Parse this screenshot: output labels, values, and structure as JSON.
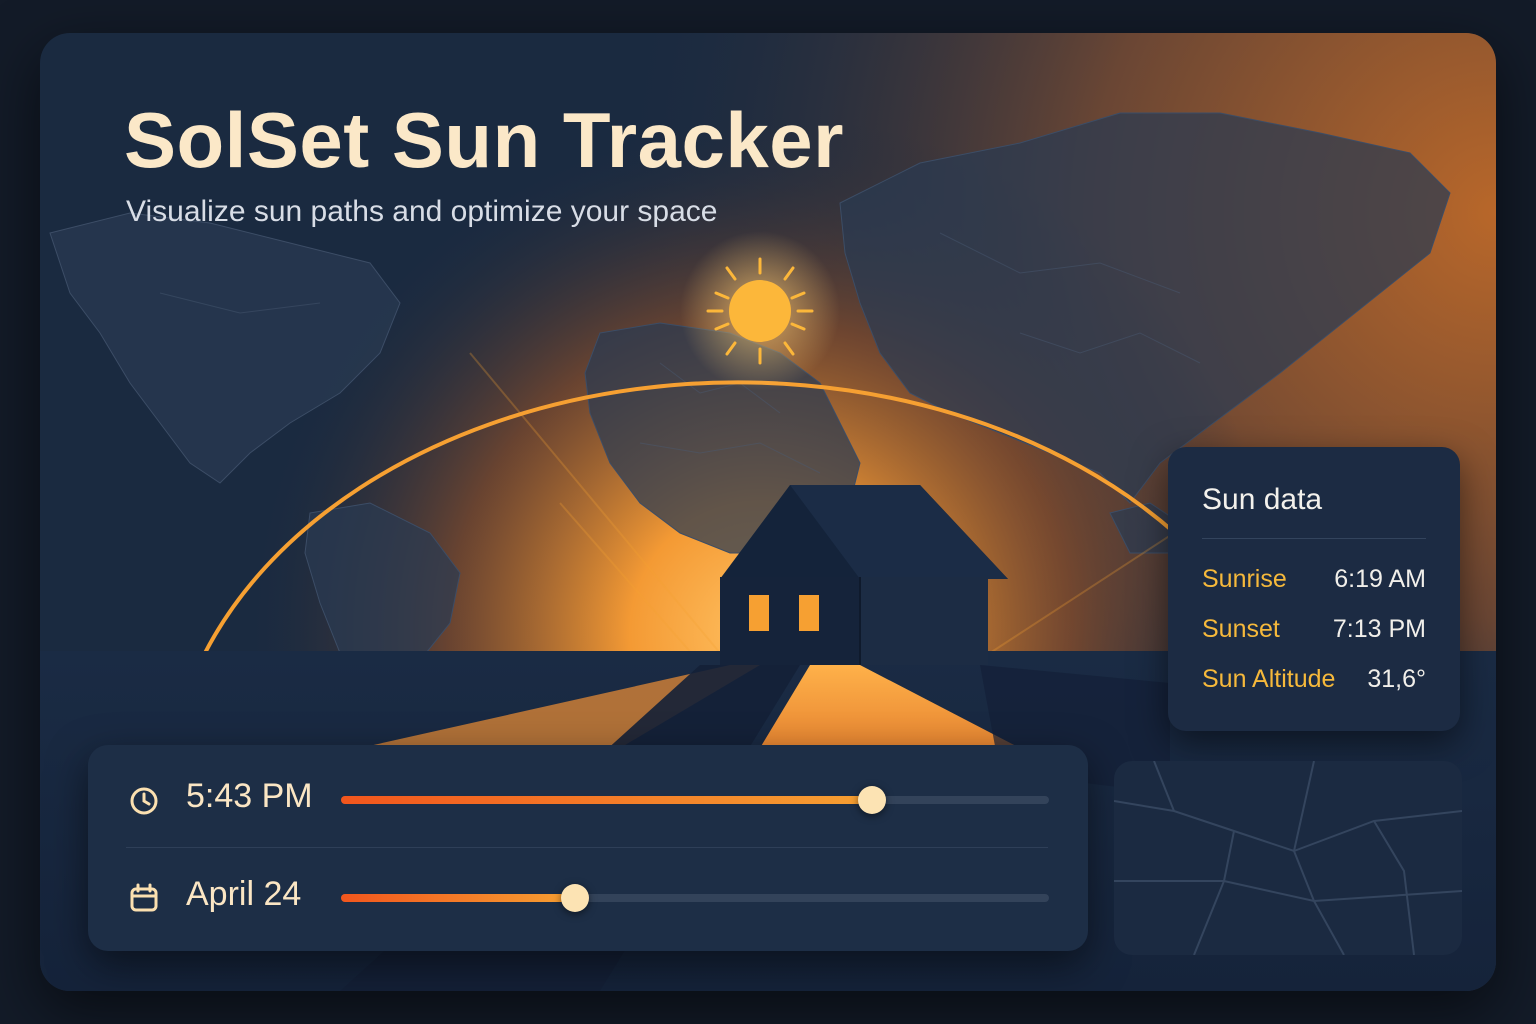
{
  "app": {
    "title": "SolSet Sun Tracker",
    "subtitle": "Visualize sun paths and optimize your space"
  },
  "sun_data": {
    "title": "Sun data",
    "rows": [
      {
        "label": "Sunrise",
        "value": "6:19 AM"
      },
      {
        "label": "Sunset",
        "value": "7:13 PM"
      },
      {
        "label": "Sun Altitude",
        "value": "31,6°"
      }
    ]
  },
  "controls": {
    "time": {
      "icon": "clock-icon",
      "value": "5:43 PM",
      "slider_fraction": 0.75
    },
    "date": {
      "icon": "calendar-icon",
      "value": "April 24",
      "slider_fraction": 0.33
    }
  },
  "colors": {
    "accent_orange": "#f6a032",
    "accent_red_orange": "#f2561d",
    "sun_yellow": "#fcb73a",
    "label_yellow": "#f6b93b",
    "title_cream": "#fbe8c8",
    "panel_bg": "#1c2b43",
    "card_bg": "#1a2a40"
  }
}
